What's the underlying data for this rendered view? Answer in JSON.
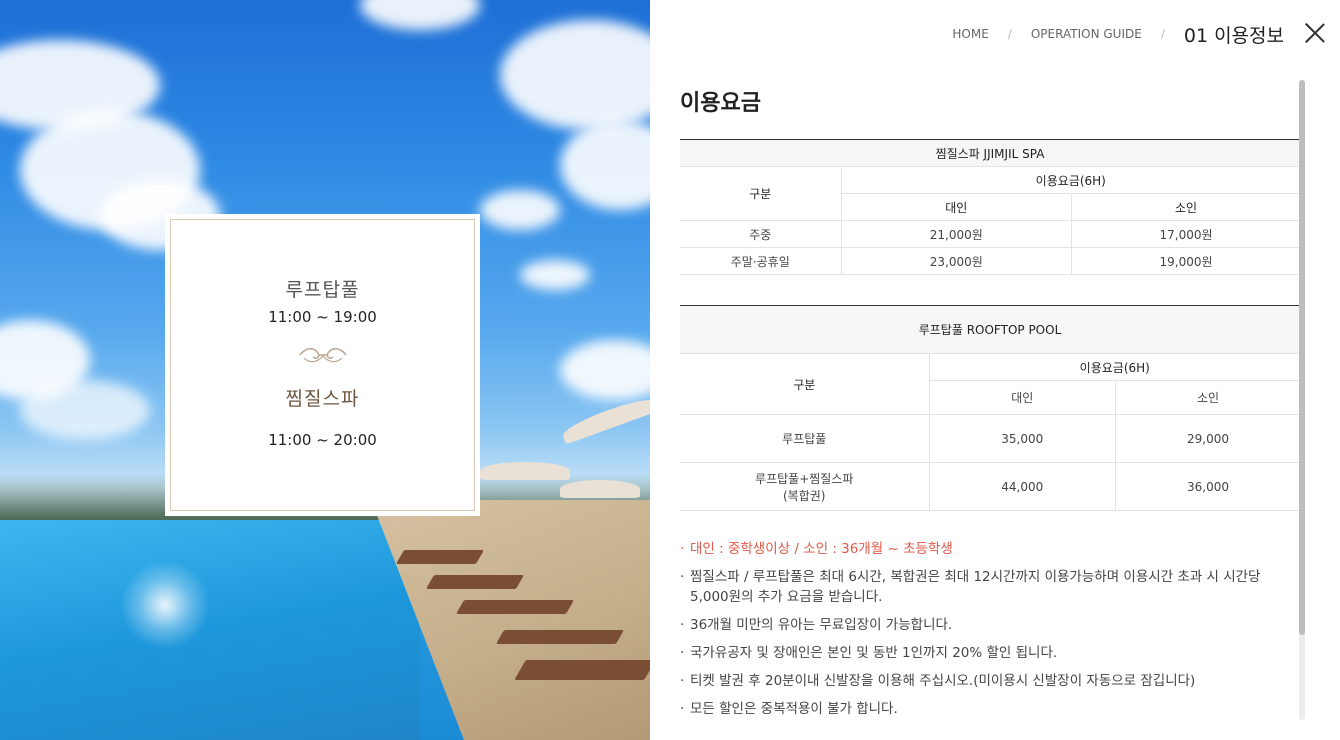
{
  "breadcrumb": {
    "home": "HOME",
    "guide": "OPERATION GUIDE",
    "current": "01 이용정보"
  },
  "hours": {
    "pool_name": "루프탑풀",
    "pool_time": "11:00 ~ 19:00",
    "spa_name": "찜질스파",
    "spa_time": "11:00 ~ 20:00"
  },
  "section_title": "이용요금",
  "spa_table": {
    "caption": "찜질스파 JJIMJIL SPA",
    "col_category": "구분",
    "col_fee": "이용요금(6H)",
    "col_adult": "대인",
    "col_child": "소인",
    "rows": [
      {
        "label": "주중",
        "adult": "21,000원",
        "child": "17,000원"
      },
      {
        "label": "주말·공휴일",
        "adult": "23,000원",
        "child": "19,000원"
      }
    ]
  },
  "pool_table": {
    "caption": "루프탑풀 ROOFTOP POOL",
    "col_category": "구분",
    "col_fee": "이용요금(6H)",
    "col_adult": "대인",
    "col_child": "소인",
    "rows": [
      {
        "label": "루프탑풀",
        "label2": "",
        "adult": "35,000",
        "child": "29,000"
      },
      {
        "label": "루프탑풀+찜질스파",
        "label2": "(복합권)",
        "adult": "44,000",
        "child": "36,000"
      }
    ]
  },
  "notes": [
    "대인 : 중학생이상 / 소인 : 36개월 ~ 초등학생",
    "찜질스파 / 루프탑풀은 최대 6시간, 복합권은 최대 12시간까지 이용가능하며 이용시간 초과 시 시간당 5,000원의 추가 요금을 받습니다.",
    "36개월 미만의 유아는 무료입장이 가능합니다.",
    "국가유공자 및 장애인은 본인 및 동반 1인까지 20% 할인 됩니다.",
    "티켓 발권 후 20분이내 신발장을 이용해 주십시오.(미이용시 신발장이 자동으로 잠깁니다)",
    "모든 할인은 중복적용이 불가 합니다."
  ],
  "colors": {
    "highlight_note": "#e0594a",
    "card_border": "#d8c9b4",
    "ornament": "#b9a690"
  }
}
